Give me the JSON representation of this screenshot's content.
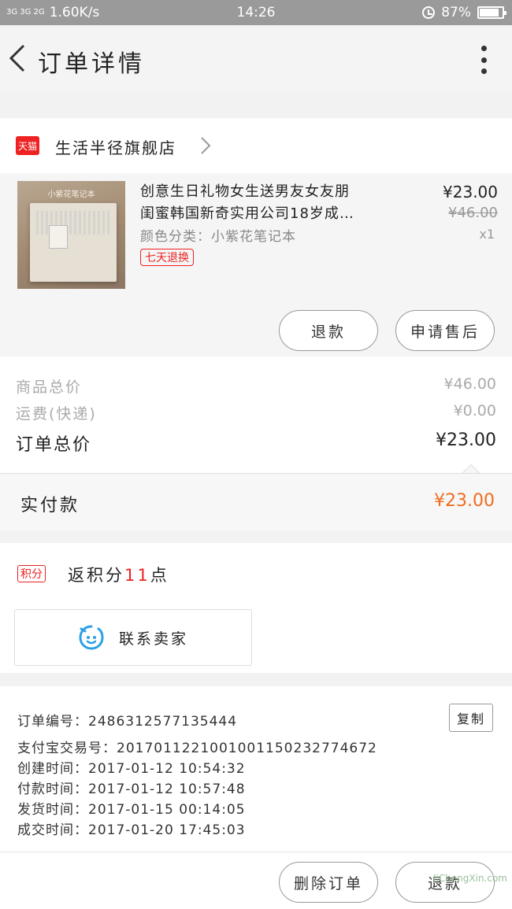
{
  "status_bar": {
    "signal_text": "3G 3G 2G",
    "speed": "1.60K/s",
    "time": "14:26",
    "battery": "87%",
    "battery_level": 0.87
  },
  "header": {
    "title": "订单详情"
  },
  "shop": {
    "badge": "天猫",
    "name": "生活半径旗舰店"
  },
  "product": {
    "image_label": "小紫花笔记本",
    "title_line1": "创意生日礼物女生送男友女友朋",
    "title_line2": "闺蜜韩国新奇实用公司18岁成…",
    "variant": "颜色分类：小紫花笔记本",
    "badge": "七天退换",
    "price": "¥23.00",
    "original_price": "¥46.00",
    "quantity": "x1",
    "refund_button": "退款",
    "aftersale_button": "申请售后"
  },
  "totals": {
    "goods_label": "商品总价",
    "goods_value": "¥46.00",
    "shipping_label": "运费(快递)",
    "shipping_value": "¥0.00",
    "order_label": "订单总价",
    "order_value": "¥23.00",
    "paid_label": "实付款",
    "paid_value": "¥23.00"
  },
  "points": {
    "badge": "积分",
    "text_prefix": "返积分",
    "number": "11",
    "text_suffix": "点",
    "contact_button": "联系卖家"
  },
  "order_info": {
    "order_no": "订单编号：2486312577135444",
    "alipay_no": "支付宝交易号：2017011221001001150232774672",
    "created": "创建时间：2017-01-12 10:54:32",
    "paid": "付款时间：2017-01-12 10:57:48",
    "shipped": "发货时间：2017-01-15 00:14:05",
    "completed": "成交时间：2017-01-20 17:45:03",
    "copy_button": "复制"
  },
  "bottom": {
    "delete_button": "删除订单",
    "refund_button": "退款"
  },
  "watermark": "JiChengXin.com",
  "colors": {
    "accent_red": "#e22",
    "paid_orange": "#f26b1d",
    "contact_icon_blue": "#2aa0e6"
  }
}
